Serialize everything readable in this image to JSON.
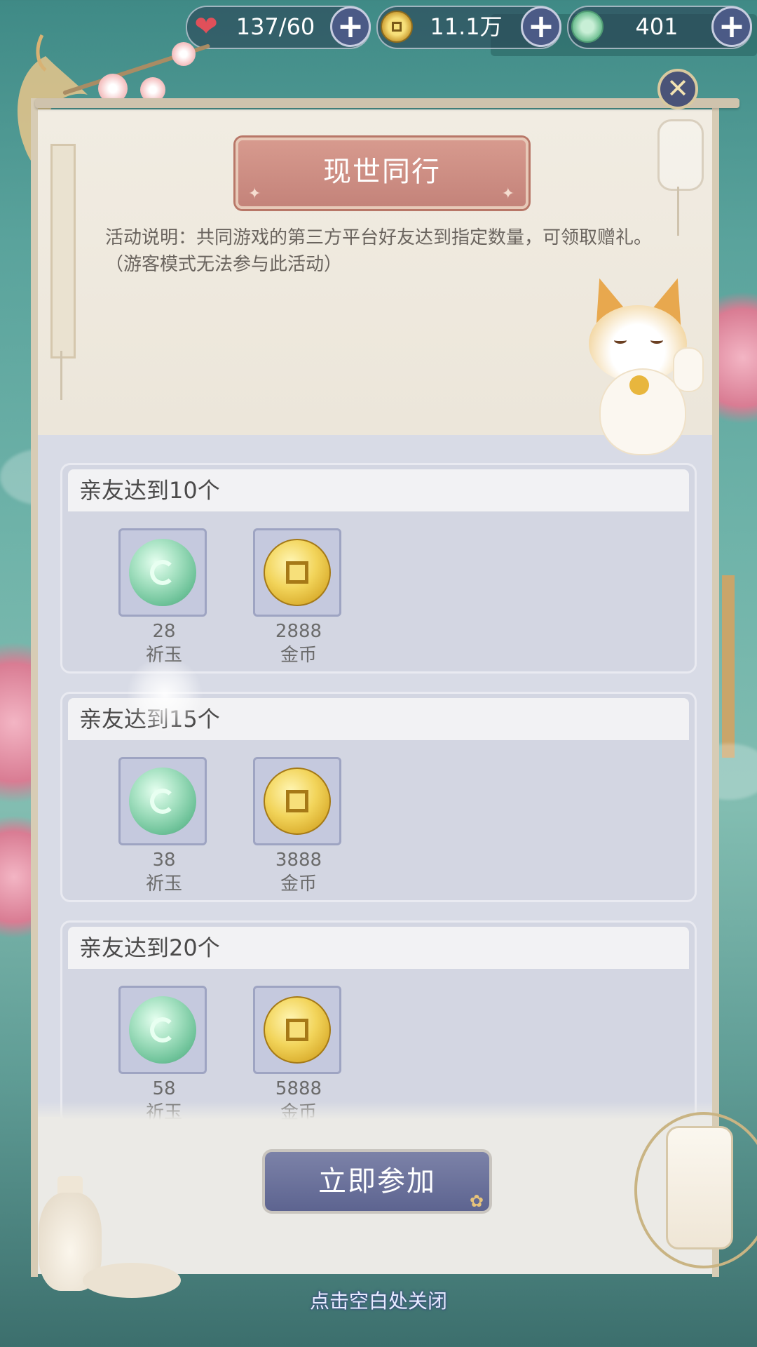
{
  "topbar": {
    "stamina": {
      "value": "137/60",
      "icon": "heart-icon"
    },
    "coins": {
      "value": "11.1万",
      "icon": "coin-icon"
    },
    "jade": {
      "value": "401",
      "icon": "jade-icon"
    },
    "plus_glyph": "+"
  },
  "panel": {
    "title": "现世同行",
    "description": "活动说明：共同游戏的第三方平台好友达到指定数量，可领取赠礼。（游客模式无法参与此活动）",
    "close_glyph": "✕"
  },
  "groups": [
    {
      "label": "亲友达到10个",
      "rewards": [
        {
          "qty": "28",
          "name": "祈玉",
          "icon": "jade-icon"
        },
        {
          "qty": "2888",
          "name": "金币",
          "icon": "coin-icon"
        }
      ]
    },
    {
      "label": "亲友达到15个",
      "rewards": [
        {
          "qty": "38",
          "name": "祈玉",
          "icon": "jade-icon"
        },
        {
          "qty": "3888",
          "name": "金币",
          "icon": "coin-icon"
        }
      ]
    },
    {
      "label": "亲友达到20个",
      "rewards": [
        {
          "qty": "58",
          "name": "祈玉",
          "icon": "jade-icon"
        },
        {
          "qty": "5888",
          "name": "金币",
          "icon": "coin-icon"
        }
      ]
    }
  ],
  "footer": {
    "join_label": "立即参加",
    "close_hint": "点击空白处关闭"
  },
  "colors": {
    "title_plate": "#c4837a",
    "button": "#5d6490",
    "panel": "#efebe1",
    "reward_area": "#d8dbe6"
  }
}
